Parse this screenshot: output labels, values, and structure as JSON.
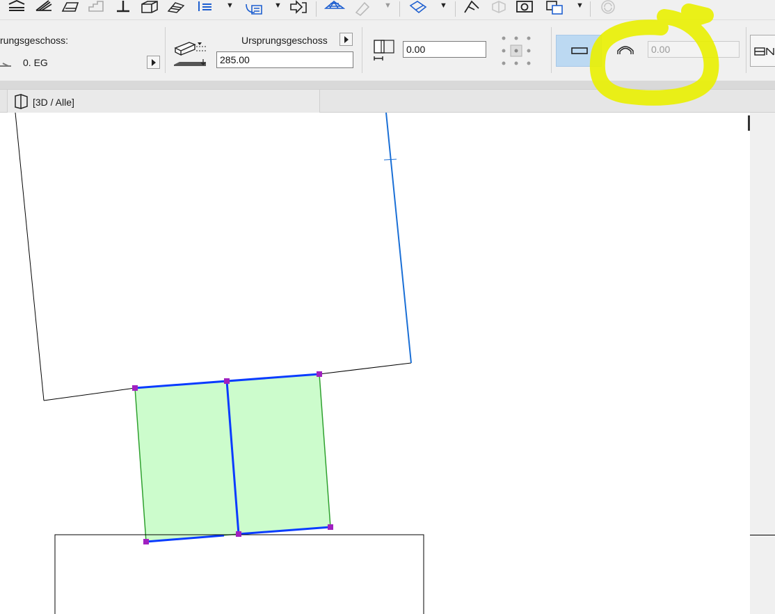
{
  "toolbar": {
    "icons": [
      "layer-lines-icon",
      "hatch-icon",
      "roof-icon",
      "stair-icon",
      "column-icon",
      "object-icon",
      "fill-icon",
      "list-icon",
      "document-icon",
      "transfer-icon",
      "mesh-grid-icon",
      "pen-disabled-icon",
      "paint-bucket-icon",
      "measure-icon",
      "shell-disabled-icon",
      "camera-icon",
      "image-icon",
      "refresh-disabled-icon"
    ]
  },
  "info_box": {
    "home_story_label": "rungsgeschoss:",
    "home_story_value": "0. EG",
    "top_link_label": "Ursprungsgeschoss",
    "height_value": "285.00",
    "offset_value": "0.00",
    "curve_value": "0.00"
  },
  "tab": {
    "label": "[3D / Alle]"
  },
  "colors": {
    "highlight": "#e9f000",
    "selection_fill": "#ccfccc",
    "selection_stroke": "#2ea02e",
    "edge_blue": "#0a3cff",
    "hotspot": "#a020c0",
    "wall_line": "#1a6fd6"
  }
}
